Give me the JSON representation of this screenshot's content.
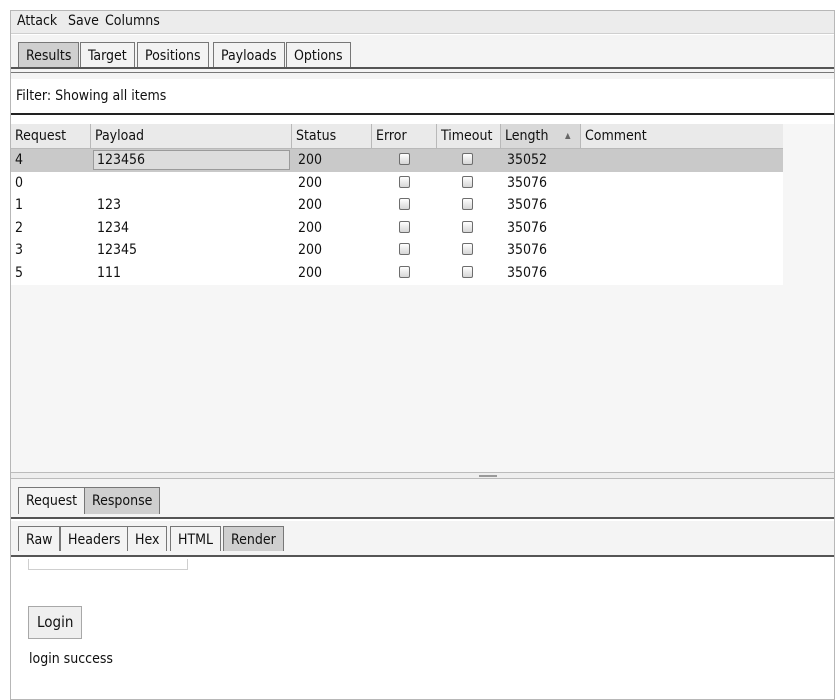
{
  "menu": [
    "Attack",
    "Save",
    "Columns"
  ],
  "top_tabs": [
    "Results",
    "Target",
    "Positions",
    "Payloads",
    "Options"
  ],
  "filter_text": "Filter: Showing all items",
  "table": {
    "columns": [
      "Request",
      "Payload",
      "Status",
      "Error",
      "Timeout",
      "Length",
      "Comment"
    ],
    "sorted_column": "Length",
    "sort_indicator": "▲",
    "rows": [
      {
        "request": "4",
        "payload": "123456",
        "status": "200",
        "error": false,
        "timeout": false,
        "length": "35052",
        "comment": ""
      },
      {
        "request": "0",
        "payload": "",
        "status": "200",
        "error": false,
        "timeout": false,
        "length": "35076",
        "comment": ""
      },
      {
        "request": "1",
        "payload": "123",
        "status": "200",
        "error": false,
        "timeout": false,
        "length": "35076",
        "comment": ""
      },
      {
        "request": "2",
        "payload": "1234",
        "status": "200",
        "error": false,
        "timeout": false,
        "length": "35076",
        "comment": ""
      },
      {
        "request": "3",
        "payload": "12345",
        "status": "200",
        "error": false,
        "timeout": false,
        "length": "35076",
        "comment": ""
      },
      {
        "request": "5",
        "payload": "111",
        "status": "200",
        "error": false,
        "timeout": false,
        "length": "35076",
        "comment": ""
      }
    ]
  },
  "lower_tabs": [
    "Request",
    "Response"
  ],
  "response_tabs": [
    "Raw",
    "Headers",
    "Hex",
    "HTML",
    "Render"
  ],
  "render": {
    "button_label": "Login",
    "message": "login success"
  }
}
